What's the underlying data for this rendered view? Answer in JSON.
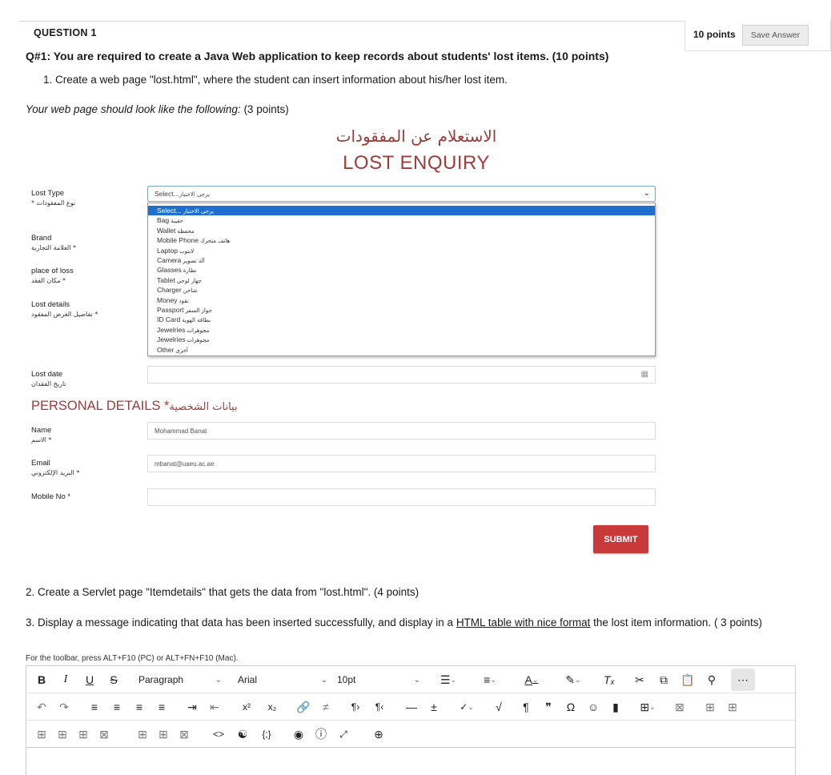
{
  "question": {
    "label": "QUESTION 1",
    "points": "10 points",
    "save_label": "Save Answer",
    "title": "Q#1:  You are required to create a Java Web application to keep records about students' lost items. (10 points)",
    "step1": "1. Create a web page \"lost.html\", where the student can insert information about his/her lost item.",
    "look_italic": "Your web page should look like the following:",
    "look_points": " (3 points)",
    "step2": "2. Create a Servlet page \"Itemdetails\" that gets the data from \"lost.html\". (4 points)",
    "step3_before": "3. Display a message indicating that data has been inserted successfully, and display in a ",
    "step3_link": "HTML table with nice format",
    "step3_after": " the lost item information.  ( 3 points)",
    "toolbar_hint": "For the toolbar, press ALT+F10 (PC) or ALT+FN+F10 (Mac)."
  },
  "form": {
    "title_ar": "الاستعلام عن المفقودات",
    "title_en": "LOST ENQUIRY",
    "labels": {
      "lost_type": "Lost Type",
      "lost_type_ar": "نوع المفقودات *",
      "brand": "Brand",
      "brand_ar": "العلامة التجارية *",
      "place": "place of loss",
      "place_ar": "مكان الفقد *",
      "details": "Lost details",
      "details_ar": "تفاصيل الغرض المفقود *",
      "date": "Lost date",
      "date_ar": "تاريخ الفقدان",
      "name": "Name",
      "name_ar": "الاسم *",
      "email": "Email",
      "email_ar": "البريد الإلكتروني *",
      "mobile": "Mobile No *"
    },
    "select_value": "Select...",
    "select_value_ar": "يرجى الاختيار",
    "options": [
      {
        "en": "Select...",
        "ar": "يرجى الاختيار",
        "selected": true
      },
      {
        "en": "Bag",
        "ar": "حقيبة"
      },
      {
        "en": "Wallet",
        "ar": "محفظة"
      },
      {
        "en": "Mobile Phone",
        "ar": "هاتف متحرك"
      },
      {
        "en": "Laptop",
        "ar": "لابتوب"
      },
      {
        "en": "Camera",
        "ar": "آلة تصوير"
      },
      {
        "en": "Glasses",
        "ar": "نظارة"
      },
      {
        "en": "Tablet",
        "ar": "جهاز لوحي"
      },
      {
        "en": "Charger",
        "ar": "شاحن"
      },
      {
        "en": "Money",
        "ar": "نقود"
      },
      {
        "en": "Passport",
        "ar": "جواز السفر"
      },
      {
        "en": "ID Card",
        "ar": "بطاقة الهوية"
      },
      {
        "en": "Jewelries",
        "ar": "مجوهرات"
      },
      {
        "en": "Jewelries",
        "ar": "مجوهرات"
      },
      {
        "en": "Other",
        "ar": "أخرى"
      }
    ],
    "personal_title": "PERSONAL DETAILS *",
    "personal_title_ar": "بيانات الشخصية",
    "name_value": "Mohammad Banat",
    "email_value": "mbanat@uaeu.ac.ae",
    "submit_label": "SUBMIT"
  },
  "editor": {
    "paragraph": "Paragraph",
    "font": "Arial",
    "size": "10pt"
  }
}
